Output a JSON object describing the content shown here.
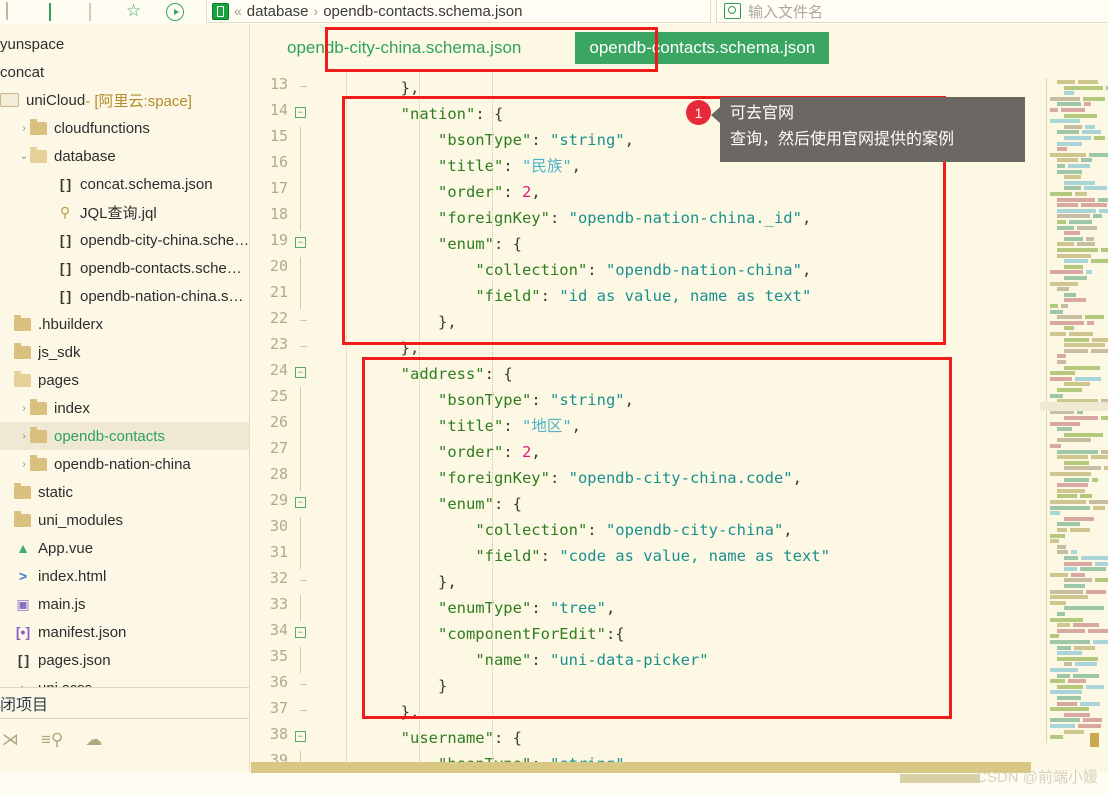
{
  "topbar": {
    "icons": [
      "window-icon",
      "back-icon",
      "forward-icon",
      "star-icon",
      "run-icon"
    ],
    "breadcrumb": {
      "badge": "J",
      "double_chevron": "«",
      "root": "database",
      "separator": "›",
      "file": "opendb-contacts.schema.json"
    },
    "search": {
      "placeholder": "输入文件名",
      "value": ""
    }
  },
  "sidebar": {
    "items": [
      {
        "label": "yunspace",
        "indent": 0,
        "kind": "text",
        "arrow": "",
        "selected": false
      },
      {
        "label": "concat",
        "indent": 0,
        "kind": "text",
        "arrow": "",
        "selected": false
      },
      {
        "label": "uniCloud",
        "suffix": " - [阿里云:space]",
        "indent": 0,
        "kind": "cloud",
        "arrow": "",
        "selected": false
      },
      {
        "label": "cloudfunctions",
        "indent": 1,
        "kind": "folder-closed",
        "arrow": "›",
        "selected": false
      },
      {
        "label": "database",
        "indent": 1,
        "kind": "folder-open",
        "arrow": "⌄",
        "selected": false
      },
      {
        "label": "concat.schema.json",
        "indent": 2,
        "kind": "json",
        "arrow": "",
        "selected": false
      },
      {
        "label": "JQL查询.jql",
        "indent": 2,
        "kind": "jql",
        "arrow": "",
        "selected": false
      },
      {
        "label": "opendb-city-china.sche…",
        "indent": 2,
        "kind": "json",
        "arrow": "",
        "selected": false
      },
      {
        "label": "opendb-contacts.sche…",
        "indent": 2,
        "kind": "json",
        "arrow": "",
        "selected": false
      },
      {
        "label": "opendb-nation-china.s…",
        "indent": 2,
        "kind": "json",
        "arrow": "",
        "selected": false
      },
      {
        "label": ".hbuilderx",
        "indent": 0,
        "kind": "folder-closed",
        "arrow": "",
        "selected": false
      },
      {
        "label": "js_sdk",
        "indent": 0,
        "kind": "folder-closed",
        "arrow": "",
        "selected": false
      },
      {
        "label": "pages",
        "indent": 0,
        "kind": "folder-open",
        "arrow": "",
        "selected": false
      },
      {
        "label": "index",
        "indent": 1,
        "kind": "folder-closed",
        "arrow": "›",
        "selected": false
      },
      {
        "label": "opendb-contacts",
        "indent": 1,
        "kind": "folder-closed",
        "arrow": "›",
        "selected": true
      },
      {
        "label": "opendb-nation-china",
        "indent": 1,
        "kind": "folder-closed",
        "arrow": "›",
        "selected": false
      },
      {
        "label": "static",
        "indent": 0,
        "kind": "folder-closed",
        "arrow": "",
        "selected": false
      },
      {
        "label": "uni_modules",
        "indent": 0,
        "kind": "folder-closed",
        "arrow": "",
        "selected": false
      },
      {
        "label": "App.vue",
        "indent": 0,
        "kind": "vue",
        "arrow": "",
        "selected": false
      },
      {
        "label": "index.html",
        "indent": 0,
        "kind": "html",
        "arrow": "",
        "selected": false
      },
      {
        "label": "main.js",
        "indent": 0,
        "kind": "js",
        "arrow": "",
        "selected": false
      },
      {
        "label": "manifest.json",
        "indent": 0,
        "kind": "manifest",
        "arrow": "",
        "selected": false
      },
      {
        "label": "pages.json",
        "indent": 0,
        "kind": "json",
        "arrow": "",
        "selected": false
      },
      {
        "label": "uni.scss",
        "indent": 0,
        "kind": "scss",
        "arrow": "",
        "selected": false
      }
    ],
    "close_project_label": "闭项目",
    "tools": [
      "branch-icon",
      "outline-search-icon",
      "cloud-icon"
    ]
  },
  "editor": {
    "tabs": [
      {
        "label": "opendb-city-china.schema.json",
        "active": false
      },
      {
        "label": "opendb-contacts.schema.json",
        "active": true
      }
    ],
    "first_line_number": 13,
    "lines": [
      {
        "num": 13,
        "fold": "tick",
        "indent": 0,
        "tokens": [
          {
            "t": "        },",
            "c": "p"
          }
        ]
      },
      {
        "num": 14,
        "fold": "minus",
        "indent": 0,
        "tokens": [
          {
            "t": "        ",
            "c": "p"
          },
          {
            "t": "\"nation\"",
            "c": "k"
          },
          {
            "t": ": {",
            "c": "p"
          }
        ]
      },
      {
        "num": 15,
        "fold": "bar",
        "indent": 0,
        "tokens": [
          {
            "t": "            ",
            "c": "p"
          },
          {
            "t": "\"bsonType\"",
            "c": "k"
          },
          {
            "t": ": ",
            "c": "p"
          },
          {
            "t": "\"string\"",
            "c": "s"
          },
          {
            "t": ",",
            "c": "p"
          }
        ]
      },
      {
        "num": 16,
        "fold": "bar",
        "indent": 0,
        "tokens": [
          {
            "t": "            ",
            "c": "p"
          },
          {
            "t": "\"title\"",
            "c": "k"
          },
          {
            "t": ": ",
            "c": "p"
          },
          {
            "t": "\"民族\"",
            "c": "cn"
          },
          {
            "t": ",",
            "c": "p"
          }
        ]
      },
      {
        "num": 17,
        "fold": "bar",
        "indent": 0,
        "tokens": [
          {
            "t": "            ",
            "c": "p"
          },
          {
            "t": "\"order\"",
            "c": "k"
          },
          {
            "t": ": ",
            "c": "p"
          },
          {
            "t": "2",
            "c": "n"
          },
          {
            "t": ",",
            "c": "p"
          }
        ]
      },
      {
        "num": 18,
        "fold": "bar",
        "indent": 0,
        "tokens": [
          {
            "t": "            ",
            "c": "p"
          },
          {
            "t": "\"foreignKey\"",
            "c": "k"
          },
          {
            "t": ": ",
            "c": "p"
          },
          {
            "t": "\"opendb-nation-china._id\"",
            "c": "s"
          },
          {
            "t": ",",
            "c": "p"
          }
        ]
      },
      {
        "num": 19,
        "fold": "minus",
        "indent": 0,
        "tokens": [
          {
            "t": "            ",
            "c": "p"
          },
          {
            "t": "\"enum\"",
            "c": "k"
          },
          {
            "t": ": {",
            "c": "p"
          }
        ]
      },
      {
        "num": 20,
        "fold": "bar",
        "indent": 0,
        "tokens": [
          {
            "t": "                ",
            "c": "p"
          },
          {
            "t": "\"collection\"",
            "c": "k"
          },
          {
            "t": ": ",
            "c": "p"
          },
          {
            "t": "\"opendb-nation-china\"",
            "c": "s"
          },
          {
            "t": ",",
            "c": "p"
          }
        ]
      },
      {
        "num": 21,
        "fold": "bar",
        "indent": 0,
        "tokens": [
          {
            "t": "                ",
            "c": "p"
          },
          {
            "t": "\"field\"",
            "c": "k"
          },
          {
            "t": ": ",
            "c": "p"
          },
          {
            "t": "\"id as value, name as text\"",
            "c": "s"
          }
        ]
      },
      {
        "num": 22,
        "fold": "tick",
        "indent": 0,
        "tokens": [
          {
            "t": "            },",
            "c": "p"
          }
        ]
      },
      {
        "num": 23,
        "fold": "tick",
        "indent": 0,
        "tokens": [
          {
            "t": "        },",
            "c": "p"
          }
        ]
      },
      {
        "num": 24,
        "fold": "minus",
        "indent": 0,
        "tokens": [
          {
            "t": "        ",
            "c": "p"
          },
          {
            "t": "\"address\"",
            "c": "k"
          },
          {
            "t": ": {",
            "c": "p"
          }
        ]
      },
      {
        "num": 25,
        "fold": "bar",
        "indent": 0,
        "tokens": [
          {
            "t": "            ",
            "c": "p"
          },
          {
            "t": "\"bsonType\"",
            "c": "k"
          },
          {
            "t": ": ",
            "c": "p"
          },
          {
            "t": "\"string\"",
            "c": "s"
          },
          {
            "t": ",",
            "c": "p"
          }
        ]
      },
      {
        "num": 26,
        "fold": "bar",
        "indent": 0,
        "tokens": [
          {
            "t": "            ",
            "c": "p"
          },
          {
            "t": "\"title\"",
            "c": "k"
          },
          {
            "t": ": ",
            "c": "p"
          },
          {
            "t": "\"地区\"",
            "c": "cn"
          },
          {
            "t": ",",
            "c": "p"
          }
        ]
      },
      {
        "num": 27,
        "fold": "bar",
        "indent": 0,
        "tokens": [
          {
            "t": "            ",
            "c": "p"
          },
          {
            "t": "\"order\"",
            "c": "k"
          },
          {
            "t": ": ",
            "c": "p"
          },
          {
            "t": "2",
            "c": "n"
          },
          {
            "t": ",",
            "c": "p"
          }
        ]
      },
      {
        "num": 28,
        "fold": "bar",
        "indent": 0,
        "tokens": [
          {
            "t": "            ",
            "c": "p"
          },
          {
            "t": "\"foreignKey\"",
            "c": "k"
          },
          {
            "t": ": ",
            "c": "p"
          },
          {
            "t": "\"opendb-city-china.code\"",
            "c": "s"
          },
          {
            "t": ",",
            "c": "p"
          }
        ]
      },
      {
        "num": 29,
        "fold": "minus",
        "indent": 0,
        "tokens": [
          {
            "t": "            ",
            "c": "p"
          },
          {
            "t": "\"enum\"",
            "c": "k"
          },
          {
            "t": ": {",
            "c": "p"
          }
        ]
      },
      {
        "num": 30,
        "fold": "bar",
        "indent": 0,
        "tokens": [
          {
            "t": "                ",
            "c": "p"
          },
          {
            "t": "\"collection\"",
            "c": "k"
          },
          {
            "t": ": ",
            "c": "p"
          },
          {
            "t": "\"opendb-city-china\"",
            "c": "s"
          },
          {
            "t": ",",
            "c": "p"
          }
        ]
      },
      {
        "num": 31,
        "fold": "bar",
        "indent": 0,
        "tokens": [
          {
            "t": "                ",
            "c": "p"
          },
          {
            "t": "\"field\"",
            "c": "k"
          },
          {
            "t": ": ",
            "c": "p"
          },
          {
            "t": "\"code as value, name as text\"",
            "c": "s"
          }
        ]
      },
      {
        "num": 32,
        "fold": "tick",
        "indent": 0,
        "tokens": [
          {
            "t": "            },",
            "c": "p"
          }
        ]
      },
      {
        "num": 33,
        "fold": "bar",
        "indent": 0,
        "tokens": [
          {
            "t": "            ",
            "c": "p"
          },
          {
            "t": "\"enumType\"",
            "c": "k"
          },
          {
            "t": ": ",
            "c": "p"
          },
          {
            "t": "\"tree\"",
            "c": "s"
          },
          {
            "t": ",",
            "c": "p"
          }
        ]
      },
      {
        "num": 34,
        "fold": "minus",
        "indent": 0,
        "tokens": [
          {
            "t": "            ",
            "c": "p"
          },
          {
            "t": "\"componentForEdit\"",
            "c": "k"
          },
          {
            "t": ":{",
            "c": "p"
          }
        ]
      },
      {
        "num": 35,
        "fold": "bar",
        "indent": 0,
        "tokens": [
          {
            "t": "                ",
            "c": "p"
          },
          {
            "t": "\"name\"",
            "c": "k"
          },
          {
            "t": ": ",
            "c": "p"
          },
          {
            "t": "\"uni-data-picker\"",
            "c": "s"
          }
        ]
      },
      {
        "num": 36,
        "fold": "tick",
        "indent": 0,
        "tokens": [
          {
            "t": "            }",
            "c": "p"
          }
        ]
      },
      {
        "num": 37,
        "fold": "tick",
        "indent": 0,
        "tokens": [
          {
            "t": "        },",
            "c": "p"
          }
        ]
      },
      {
        "num": 38,
        "fold": "minus",
        "indent": 0,
        "tokens": [
          {
            "t": "        ",
            "c": "p"
          },
          {
            "t": "\"username\"",
            "c": "k"
          },
          {
            "t": ": {",
            "c": "p"
          }
        ]
      },
      {
        "num": 39,
        "fold": "bar",
        "indent": 0,
        "tokens": [
          {
            "t": "            ",
            "c": "p"
          },
          {
            "t": "\"bsonType\"",
            "c": "k"
          },
          {
            "t": ": ",
            "c": "p"
          },
          {
            "t": "\"string\"",
            "c": "s"
          },
          {
            "t": ",",
            "c": "p"
          }
        ]
      }
    ]
  },
  "annotations": {
    "marker_number": "1",
    "callout_line1": "可去官网",
    "callout_line2": "查询，然后使用官网提供的案例",
    "boxes": [
      "nation-block-highlight",
      "address-block-highlight",
      "active-tab-highlight"
    ]
  },
  "watermark": "CSDN @前端小媛",
  "colors": {
    "background": "#fdf8e4",
    "accent_green": "#2fa25a",
    "active_tab_bg": "#3aa661",
    "annotation_red": "#ef1c1c",
    "callout_bg": "#6b6762",
    "marker_red": "#e8293a",
    "key_green": "#2f7d1f",
    "string_teal": "#1a9090",
    "number_pink": "#d81b7a",
    "linenum": "#b0a98c",
    "scrollbar": "#d9c884"
  }
}
